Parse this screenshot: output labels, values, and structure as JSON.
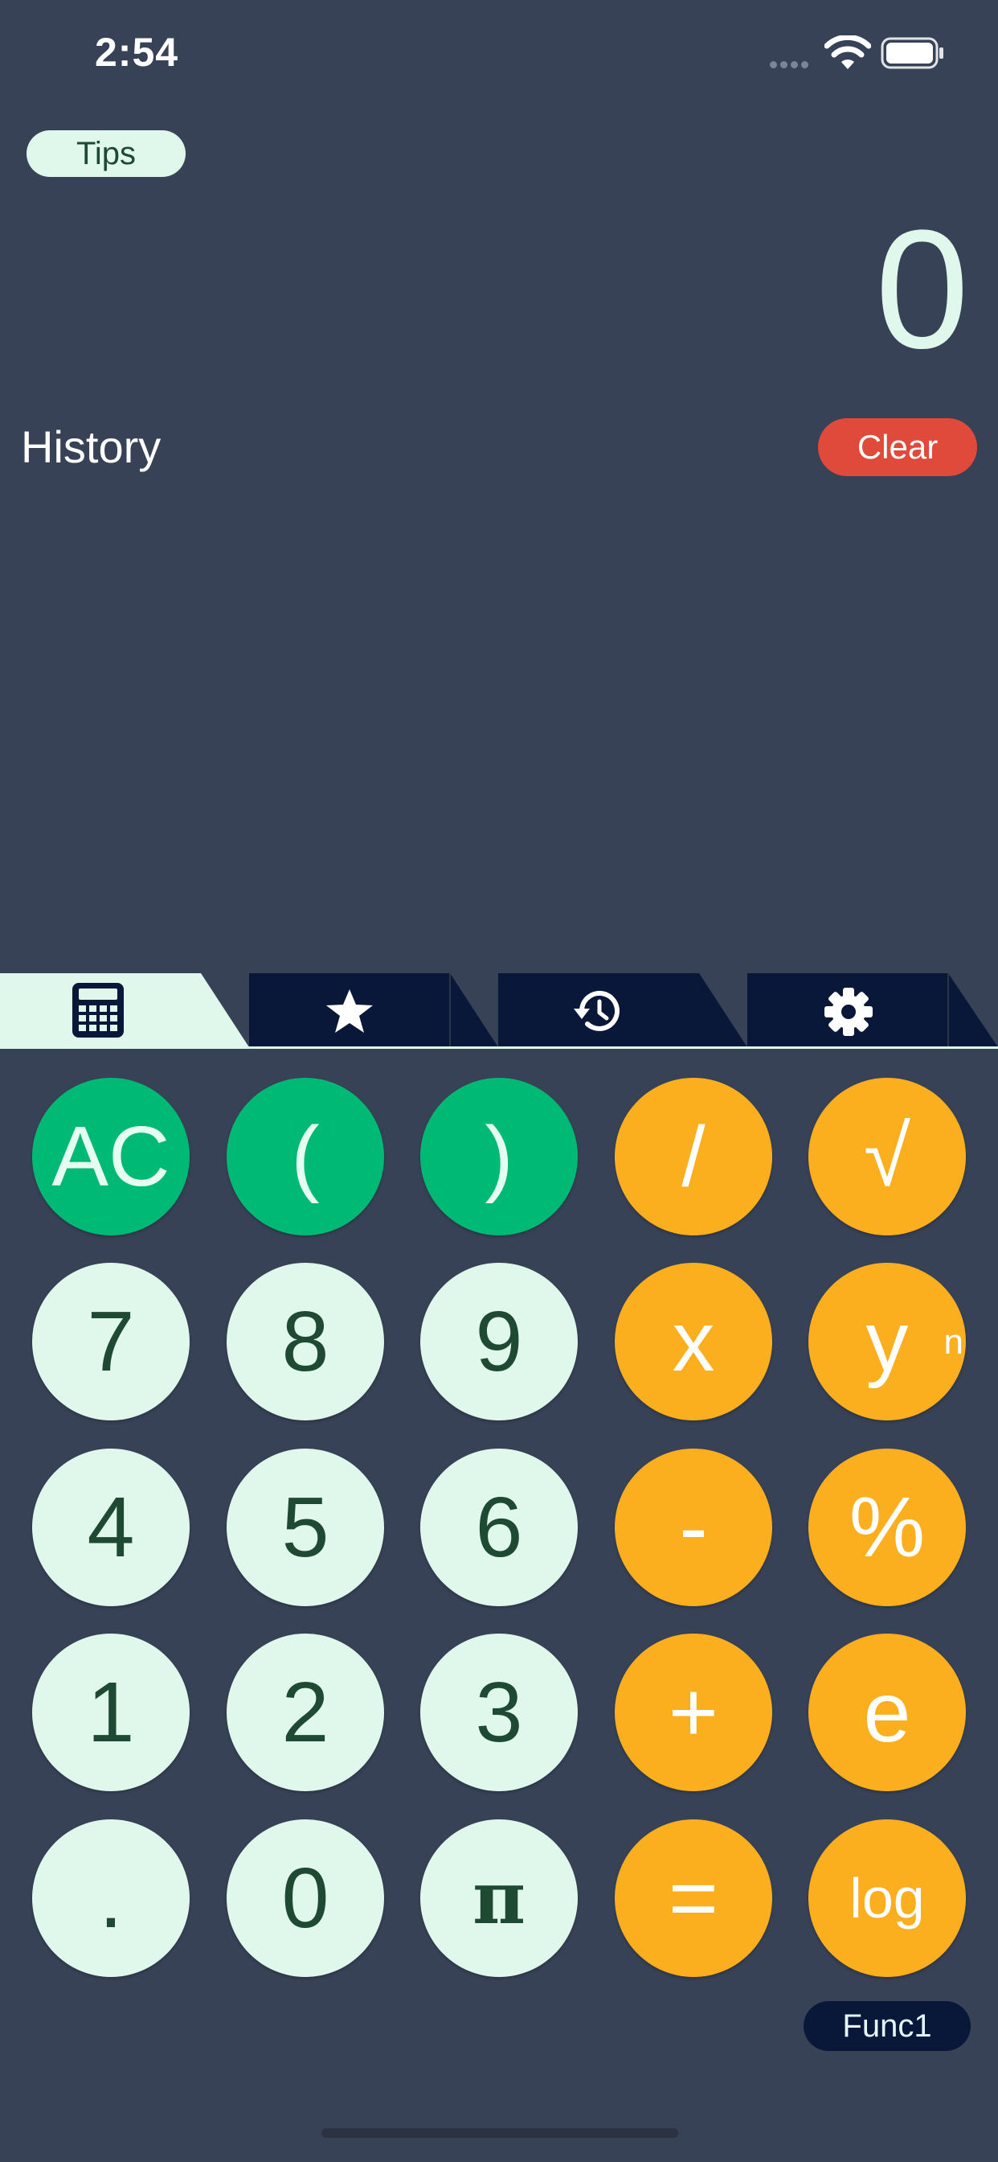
{
  "status_bar": {
    "time": "2:54"
  },
  "header": {
    "tips_label": "Tips",
    "display_value": "0",
    "history_title": "History",
    "clear_label": "Clear"
  },
  "tabs": [
    {
      "icon": "calculator-icon",
      "active": true
    },
    {
      "icon": "star-icon",
      "active": false
    },
    {
      "icon": "history-icon",
      "active": false
    },
    {
      "icon": "gear-icon",
      "active": false
    }
  ],
  "keypad": {
    "rows": [
      [
        {
          "label": "AC",
          "style": "green"
        },
        {
          "label": "(",
          "style": "green"
        },
        {
          "label": ")",
          "style": "green"
        },
        {
          "label": "/",
          "style": "orange"
        },
        {
          "label": "√",
          "style": "orange"
        }
      ],
      [
        {
          "label": "7",
          "style": "light"
        },
        {
          "label": "8",
          "style": "light"
        },
        {
          "label": "9",
          "style": "light"
        },
        {
          "label": "x",
          "style": "orange"
        },
        {
          "label": "y",
          "sup": "n",
          "style": "orange"
        }
      ],
      [
        {
          "label": "4",
          "style": "light"
        },
        {
          "label": "5",
          "style": "light"
        },
        {
          "label": "6",
          "style": "light"
        },
        {
          "label": "-",
          "style": "orange"
        },
        {
          "label": "%",
          "style": "orange"
        }
      ],
      [
        {
          "label": "1",
          "style": "light"
        },
        {
          "label": "2",
          "style": "light"
        },
        {
          "label": "3",
          "style": "light"
        },
        {
          "label": "+",
          "style": "orange"
        },
        {
          "label": "e",
          "style": "orange"
        }
      ],
      [
        {
          "label": ".",
          "style": "light"
        },
        {
          "label": "0",
          "style": "light"
        },
        {
          "label": "π",
          "style": "light"
        },
        {
          "label": "=",
          "style": "orange"
        },
        {
          "label": "log",
          "style": "orange"
        }
      ]
    ]
  },
  "func_label": "Func1",
  "colors": {
    "background": "#384256",
    "green": "#00b974",
    "orange": "#fbae1e",
    "light": "#e0f7ec",
    "dark_text": "#1e4a34",
    "clear_red": "#e04a3a",
    "tab_dark": "#091838"
  }
}
